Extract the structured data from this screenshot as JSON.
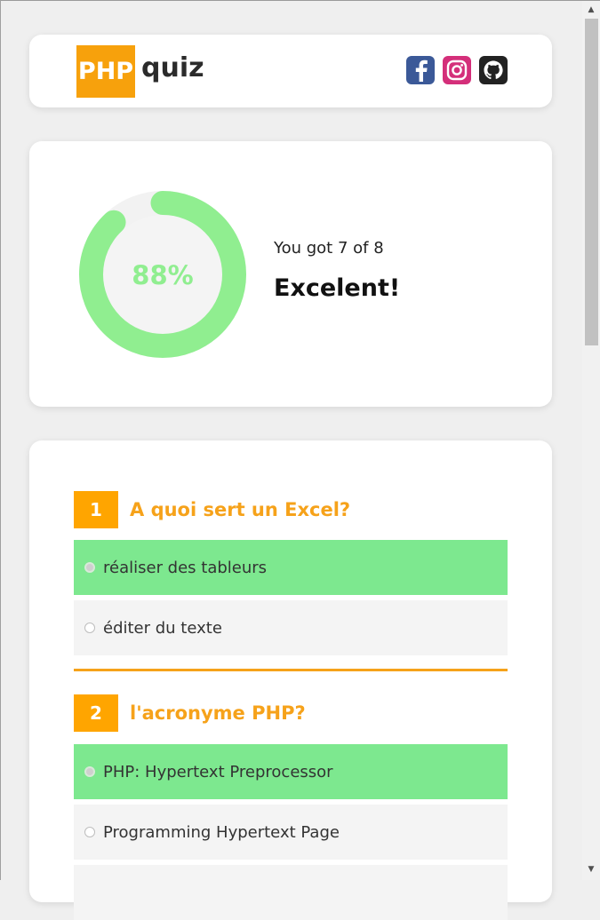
{
  "header": {
    "logo_badge": "PHP",
    "logo_text": "quiz",
    "social": [
      "facebook-icon",
      "instagram-icon",
      "github-icon"
    ]
  },
  "score": {
    "percent_label": "88%",
    "progress": 0.88,
    "result_line": "You got 7 of 8",
    "grade": "Excelent!"
  },
  "questions": [
    {
      "number": "1",
      "title": "A quoi sert un Excel?",
      "options": [
        {
          "label": "réaliser des tableurs",
          "correct": true
        },
        {
          "label": "éditer du texte",
          "correct": false
        }
      ]
    },
    {
      "number": "2",
      "title": "l'acronyme PHP?",
      "options": [
        {
          "label": "PHP: Hypertext Preprocessor",
          "correct": true
        },
        {
          "label": "Programming Hypertext Page",
          "correct": false
        }
      ]
    }
  ],
  "colors": {
    "brand_orange": "#f7a10c",
    "correct_green": "#7de88f",
    "gauge_green": "#90ee90"
  }
}
